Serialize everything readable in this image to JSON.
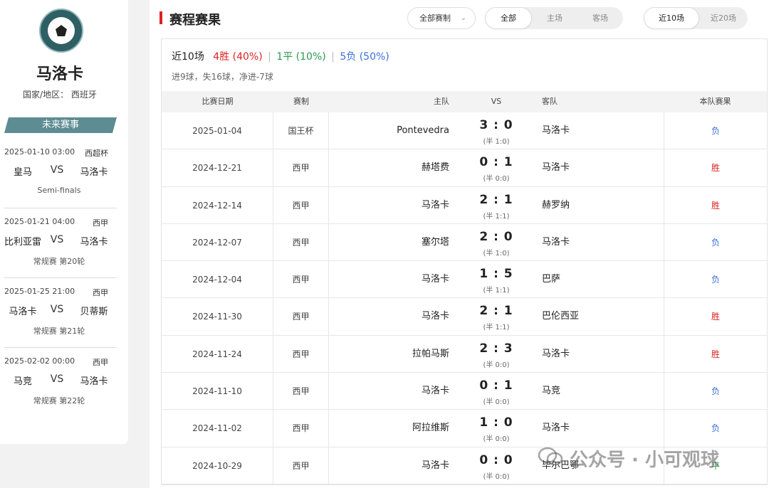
{
  "team": {
    "name": "马洛卡",
    "region_label": "国家/地区：",
    "region_value": "西班牙"
  },
  "upcoming": {
    "title": "未来赛事",
    "matches": [
      {
        "datetime": "2025-01-10 03:00",
        "competition": "西超杯",
        "home": "皇马",
        "vs": "VS",
        "away": "马洛卡",
        "stage": "Semi-finals"
      },
      {
        "datetime": "2025-01-21 04:00",
        "competition": "西甲",
        "home": "比利亚雷",
        "vs": "VS",
        "away": "马洛卡",
        "stage": "常规赛  第20轮"
      },
      {
        "datetime": "2025-01-25 21:00",
        "competition": "西甲",
        "home": "马洛卡",
        "vs": "VS",
        "away": "贝蒂斯",
        "stage": "常规赛  第21轮"
      },
      {
        "datetime": "2025-02-02 00:00",
        "competition": "西甲",
        "home": "马竞",
        "vs": "VS",
        "away": "马洛卡",
        "stage": "常规赛  第22轮"
      }
    ]
  },
  "main": {
    "title": "赛程赛果",
    "dropdown_label": "全部赛制",
    "venue_tabs": [
      "全部",
      "主场",
      "客场"
    ],
    "venue_active": 0,
    "range_tabs": [
      "近10场",
      "近20场"
    ],
    "range_active": 0
  },
  "summary": {
    "label": "近10场",
    "wins": "4胜 (40%)",
    "draws": "1平 (10%)",
    "losses": "5负 (50%)",
    "sep": "|",
    "goals": "进9球，失16球，净进-7球"
  },
  "table": {
    "headers": {
      "date": "比赛日期",
      "comp": "赛制",
      "home": "主队",
      "vs": "VS",
      "away": "客队",
      "result": "本队赛果"
    },
    "rows": [
      {
        "date": "2025-01-04",
        "comp": "国王杯",
        "home": "Pontevedra",
        "score": "3 : 0",
        "half": "(半 1:0)",
        "away": "马洛卡",
        "result": "负",
        "type": "loss"
      },
      {
        "date": "2024-12-21",
        "comp": "西甲",
        "home": "赫塔费",
        "score": "0 : 1",
        "half": "(半 0:0)",
        "away": "马洛卡",
        "result": "胜",
        "type": "win"
      },
      {
        "date": "2024-12-14",
        "comp": "西甲",
        "home": "马洛卡",
        "score": "2 : 1",
        "half": "(半 1:1)",
        "away": "赫罗纳",
        "result": "胜",
        "type": "win"
      },
      {
        "date": "2024-12-07",
        "comp": "西甲",
        "home": "塞尔塔",
        "score": "2 : 0",
        "half": "(半 1:0)",
        "away": "马洛卡",
        "result": "负",
        "type": "loss"
      },
      {
        "date": "2024-12-04",
        "comp": "西甲",
        "home": "马洛卡",
        "score": "1 : 5",
        "half": "(半 1:1)",
        "away": "巴萨",
        "result": "负",
        "type": "loss"
      },
      {
        "date": "2024-11-30",
        "comp": "西甲",
        "home": "马洛卡",
        "score": "2 : 1",
        "half": "(半 1:1)",
        "away": "巴伦西亚",
        "result": "胜",
        "type": "win"
      },
      {
        "date": "2024-11-24",
        "comp": "西甲",
        "home": "拉帕马斯",
        "score": "2 : 3",
        "half": "(半 0:0)",
        "away": "马洛卡",
        "result": "胜",
        "type": "win"
      },
      {
        "date": "2024-11-10",
        "comp": "西甲",
        "home": "马洛卡",
        "score": "0 : 1",
        "half": "(半 0:0)",
        "away": "马竞",
        "result": "负",
        "type": "loss"
      },
      {
        "date": "2024-11-02",
        "comp": "西甲",
        "home": "阿拉维斯",
        "score": "1 : 0",
        "half": "(半 0:0)",
        "away": "马洛卡",
        "result": "负",
        "type": "loss"
      },
      {
        "date": "2024-10-29",
        "comp": "西甲",
        "home": "马洛卡",
        "score": "0 : 0",
        "half": "(半 0:0)",
        "away": "毕尔巴鄂",
        "result": "平",
        "type": "draw"
      }
    ]
  },
  "watermark": "公众号 · 小可观球"
}
